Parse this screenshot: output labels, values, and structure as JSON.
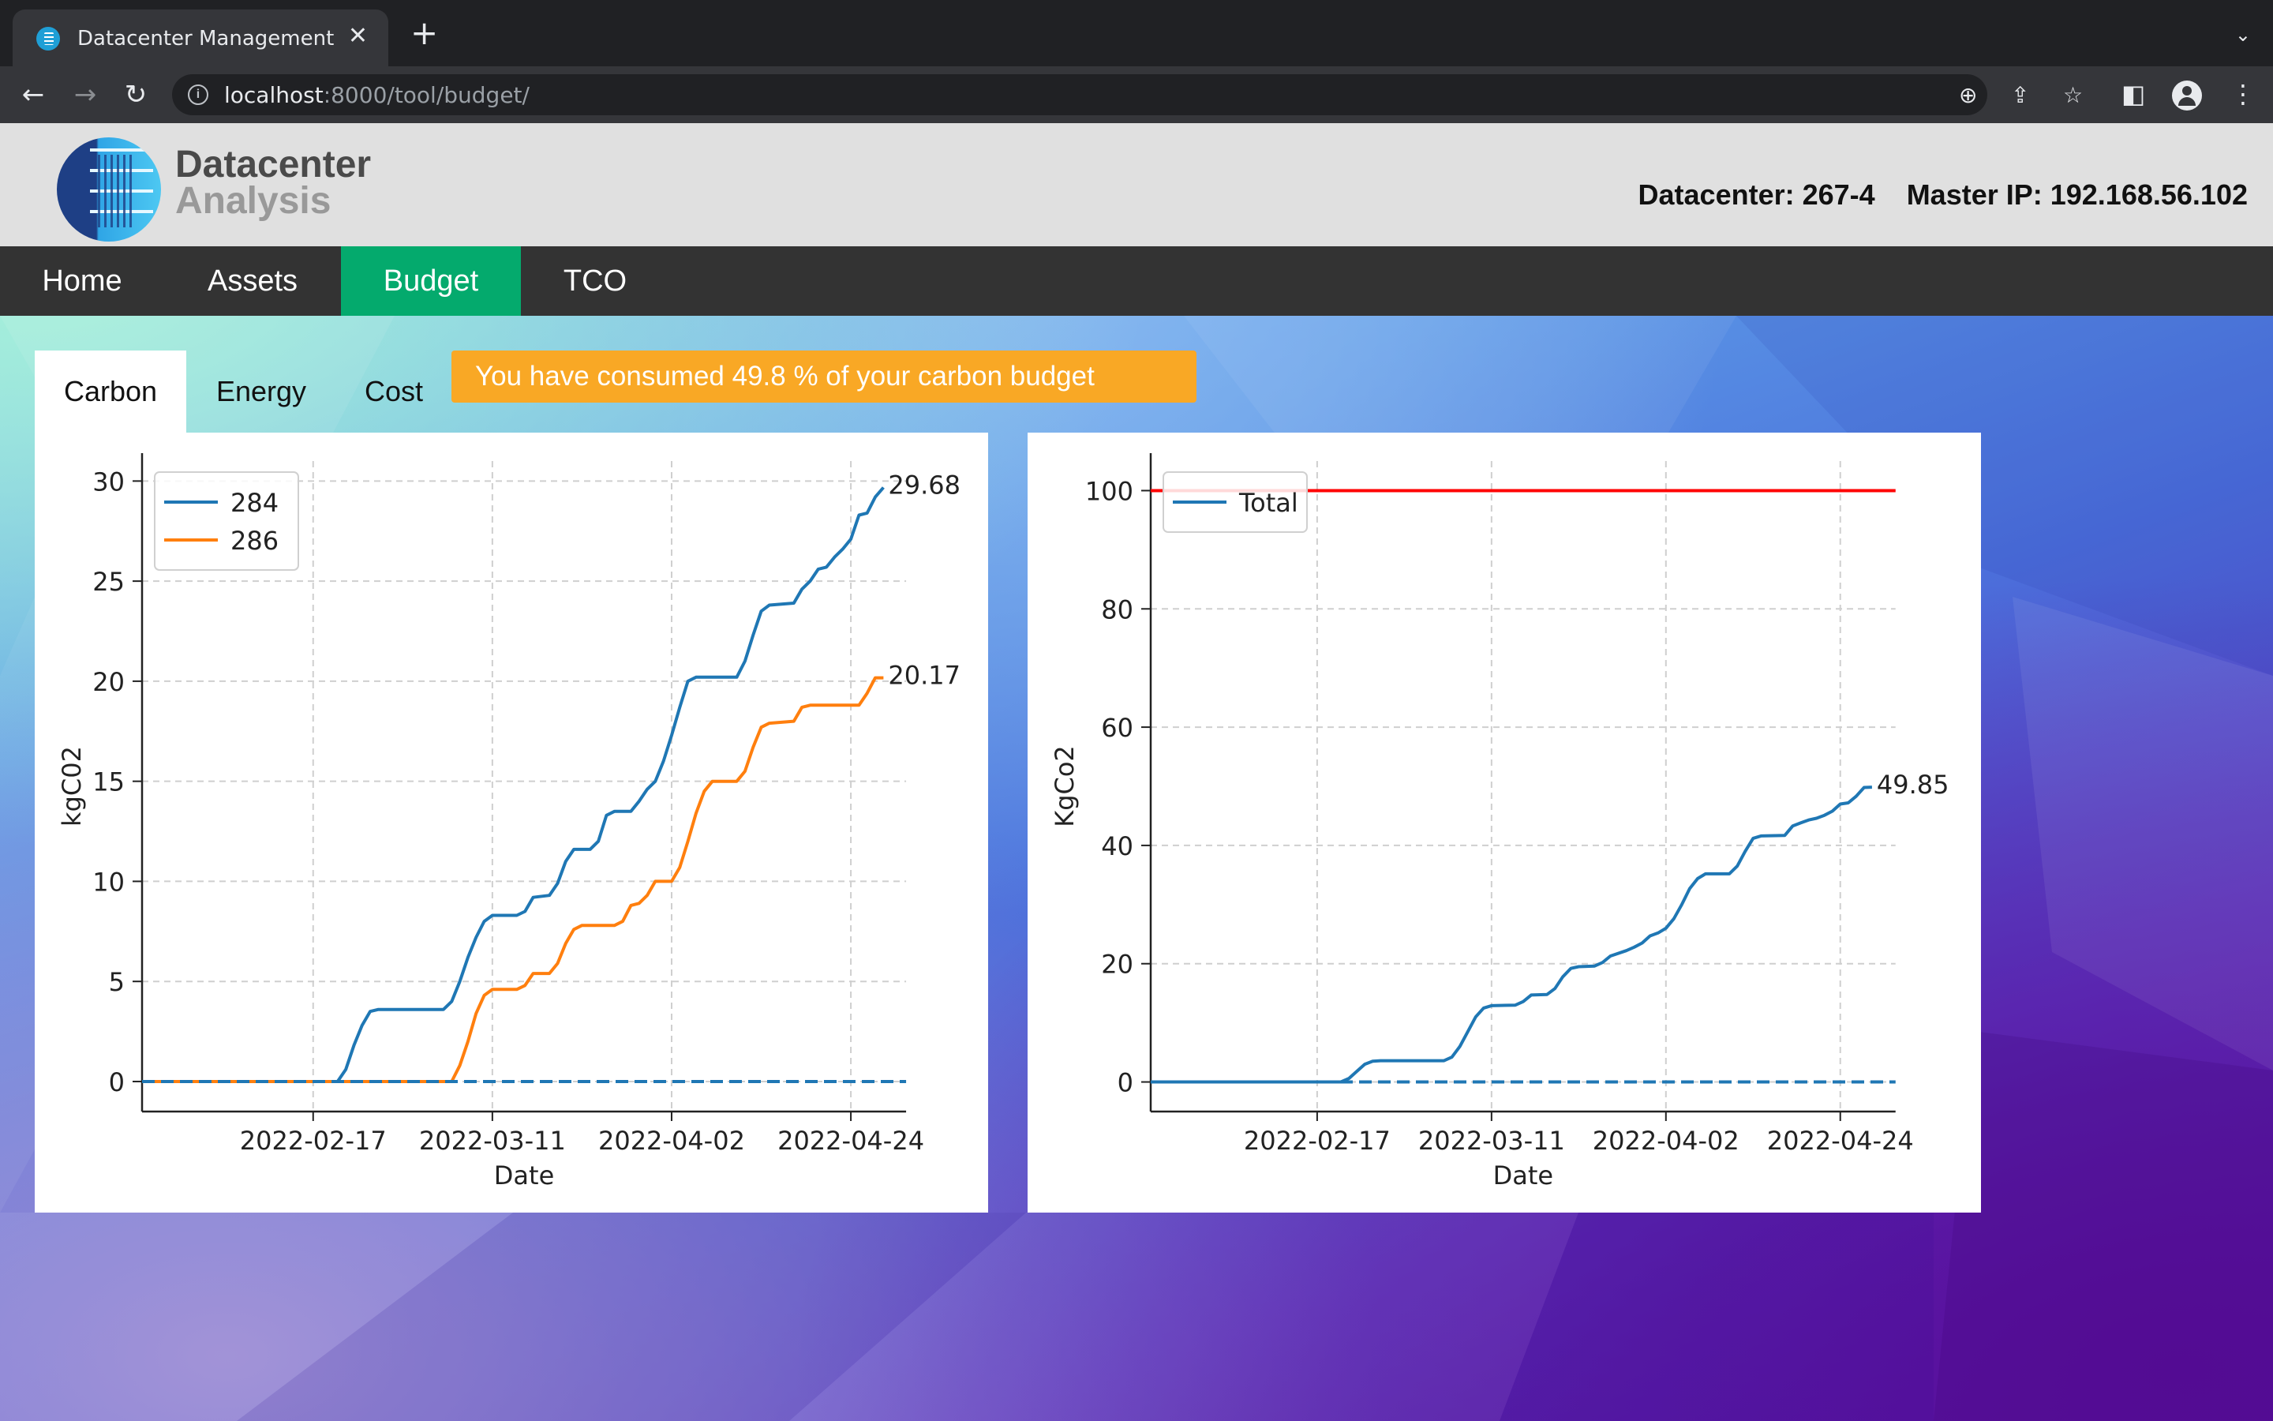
{
  "browser": {
    "tab_title": "Datacenter Management",
    "tab_close": "✕",
    "new_tab": "+",
    "tab_search": "⌄",
    "url_host": "localhost",
    "url_path": ":8000/tool/budget/",
    "back": "←",
    "forward": "→",
    "reload": "↻",
    "zoom": "⊕",
    "share": "⇪",
    "bookmark": "☆",
    "side_panel": "◧",
    "menu": "⋮"
  },
  "header": {
    "logo_title": "Datacenter",
    "logo_subtitle": "Analysis",
    "datacenter": "Datacenter: 267-4",
    "master_ip": "Master IP: 192.168.56.102"
  },
  "nav": {
    "items": [
      {
        "label": "Home",
        "active": false
      },
      {
        "label": "Assets",
        "active": false
      },
      {
        "label": "Budget",
        "active": true
      },
      {
        "label": "TCO",
        "active": false
      }
    ]
  },
  "subtabs": [
    {
      "label": "Carbon",
      "active": true
    },
    {
      "label": "Energy",
      "active": false
    },
    {
      "label": "Cost",
      "active": false
    }
  ],
  "alert": {
    "text": "You have consumed 49.8 % of your carbon budget",
    "color": "#f9a825"
  },
  "colors": {
    "nav_active": "#04aa6d",
    "series_blue": "#1f77b4",
    "series_orange": "#ff7f0e",
    "limit_red": "#ff0000"
  },
  "chart_data": [
    {
      "type": "line",
      "xlabel": "Date",
      "ylabel": "kgC02",
      "xlim": [
        "2022-01-27",
        "2022-04-30"
      ],
      "ylim": [
        -1.5,
        31
      ],
      "yticks": [
        0,
        5,
        10,
        15,
        20,
        25,
        30
      ],
      "xticks": [
        "2022-02-17",
        "2022-03-11",
        "2022-04-02",
        "2022-04-24"
      ],
      "grid": true,
      "legend": "top-left",
      "end_labels": [
        "29.68",
        "20.17"
      ],
      "zero_line": {
        "value": 0,
        "style": "dashed"
      },
      "series": [
        {
          "name": "284",
          "color": "#1f77b4",
          "points": [
            [
              "2022-01-27",
              0
            ],
            [
              "2022-02-20",
              0
            ],
            [
              "2022-02-21",
              0.6
            ],
            [
              "2022-02-22",
              1.8
            ],
            [
              "2022-02-23",
              2.8
            ],
            [
              "2022-02-24",
              3.5
            ],
            [
              "2022-02-25",
              3.6
            ],
            [
              "2022-02-28",
              3.6
            ],
            [
              "2022-03-05",
              3.6
            ],
            [
              "2022-03-06",
              4.0
            ],
            [
              "2022-03-07",
              5.0
            ],
            [
              "2022-03-08",
              6.2
            ],
            [
              "2022-03-09",
              7.2
            ],
            [
              "2022-03-10",
              8.0
            ],
            [
              "2022-03-11",
              8.3
            ],
            [
              "2022-03-14",
              8.3
            ],
            [
              "2022-03-15",
              8.5
            ],
            [
              "2022-03-16",
              9.2
            ],
            [
              "2022-03-18",
              9.3
            ],
            [
              "2022-03-19",
              9.9
            ],
            [
              "2022-03-20",
              11.0
            ],
            [
              "2022-03-21",
              11.6
            ],
            [
              "2022-03-23",
              11.6
            ],
            [
              "2022-03-24",
              12.0
            ],
            [
              "2022-03-25",
              13.3
            ],
            [
              "2022-03-26",
              13.5
            ],
            [
              "2022-03-28",
              13.5
            ],
            [
              "2022-03-29",
              14.0
            ],
            [
              "2022-03-30",
              14.6
            ],
            [
              "2022-03-31",
              15.0
            ],
            [
              "2022-04-01",
              16.0
            ],
            [
              "2022-04-02",
              17.3
            ],
            [
              "2022-04-03",
              18.7
            ],
            [
              "2022-04-04",
              20.0
            ],
            [
              "2022-04-05",
              20.2
            ],
            [
              "2022-04-10",
              20.2
            ],
            [
              "2022-04-11",
              21.0
            ],
            [
              "2022-04-12",
              22.3
            ],
            [
              "2022-04-13",
              23.5
            ],
            [
              "2022-04-14",
              23.8
            ],
            [
              "2022-04-17",
              23.9
            ],
            [
              "2022-04-18",
              24.6
            ],
            [
              "2022-04-19",
              25.0
            ],
            [
              "2022-04-20",
              25.6
            ],
            [
              "2022-04-21",
              25.7
            ],
            [
              "2022-04-22",
              26.2
            ],
            [
              "2022-04-23",
              26.6
            ],
            [
              "2022-04-24",
              27.1
            ],
            [
              "2022-04-25",
              28.3
            ],
            [
              "2022-04-26",
              28.4
            ],
            [
              "2022-04-27",
              29.2
            ],
            [
              "2022-04-28",
              29.68
            ]
          ]
        },
        {
          "name": "286",
          "color": "#ff7f0e",
          "points": [
            [
              "2022-01-27",
              0
            ],
            [
              "2022-03-06",
              0
            ],
            [
              "2022-03-07",
              0.8
            ],
            [
              "2022-03-08",
              2.0
            ],
            [
              "2022-03-09",
              3.4
            ],
            [
              "2022-03-10",
              4.3
            ],
            [
              "2022-03-11",
              4.6
            ],
            [
              "2022-03-14",
              4.6
            ],
            [
              "2022-03-15",
              4.8
            ],
            [
              "2022-03-16",
              5.4
            ],
            [
              "2022-03-18",
              5.4
            ],
            [
              "2022-03-19",
              5.9
            ],
            [
              "2022-03-20",
              6.9
            ],
            [
              "2022-03-21",
              7.6
            ],
            [
              "2022-03-22",
              7.8
            ],
            [
              "2022-03-26",
              7.8
            ],
            [
              "2022-03-27",
              8.0
            ],
            [
              "2022-03-28",
              8.8
            ],
            [
              "2022-03-29",
              8.9
            ],
            [
              "2022-03-30",
              9.3
            ],
            [
              "2022-03-31",
              10.0
            ],
            [
              "2022-04-02",
              10.0
            ],
            [
              "2022-04-03",
              10.7
            ],
            [
              "2022-04-04",
              12.0
            ],
            [
              "2022-04-05",
              13.4
            ],
            [
              "2022-04-06",
              14.5
            ],
            [
              "2022-04-07",
              15.0
            ],
            [
              "2022-04-10",
              15.0
            ],
            [
              "2022-04-11",
              15.5
            ],
            [
              "2022-04-12",
              16.7
            ],
            [
              "2022-04-13",
              17.7
            ],
            [
              "2022-04-14",
              17.9
            ],
            [
              "2022-04-17",
              18.0
            ],
            [
              "2022-04-18",
              18.7
            ],
            [
              "2022-04-19",
              18.8
            ],
            [
              "2022-04-24",
              18.8
            ],
            [
              "2022-04-25",
              18.8
            ],
            [
              "2022-04-26",
              19.4
            ],
            [
              "2022-04-27",
              20.17
            ],
            [
              "2022-04-28",
              20.17
            ]
          ]
        }
      ]
    },
    {
      "type": "line",
      "xlabel": "Date",
      "ylabel": "KgCo2",
      "xlim": [
        "2022-01-27",
        "2022-04-30"
      ],
      "ylim": [
        -5,
        105
      ],
      "yticks": [
        0,
        20,
        40,
        60,
        80,
        100
      ],
      "xticks": [
        "2022-02-17",
        "2022-03-11",
        "2022-04-02",
        "2022-04-24"
      ],
      "grid": true,
      "legend": "top-left",
      "end_labels": [
        "49.85"
      ],
      "zero_line": {
        "value": 0,
        "style": "dashed"
      },
      "limit_line": {
        "value": 100,
        "color": "#ff0000"
      },
      "series": [
        {
          "name": "Total",
          "color": "#1f77b4",
          "points": [
            [
              "2022-01-27",
              0
            ],
            [
              "2022-02-20",
              0
            ],
            [
              "2022-02-21",
              0.6
            ],
            [
              "2022-02-22",
              1.8
            ],
            [
              "2022-02-23",
              3.0
            ],
            [
              "2022-02-24",
              3.5
            ],
            [
              "2022-02-25",
              3.6
            ],
            [
              "2022-03-05",
              3.6
            ],
            [
              "2022-03-06",
              4.2
            ],
            [
              "2022-03-07",
              6.0
            ],
            [
              "2022-03-08",
              8.5
            ],
            [
              "2022-03-09",
              11.0
            ],
            [
              "2022-03-10",
              12.5
            ],
            [
              "2022-03-11",
              12.9
            ],
            [
              "2022-03-14",
              13.0
            ],
            [
              "2022-03-15",
              13.6
            ],
            [
              "2022-03-16",
              14.7
            ],
            [
              "2022-03-18",
              14.8
            ],
            [
              "2022-03-19",
              15.8
            ],
            [
              "2022-03-20",
              17.8
            ],
            [
              "2022-03-21",
              19.2
            ],
            [
              "2022-03-22",
              19.5
            ],
            [
              "2022-03-24",
              19.6
            ],
            [
              "2022-03-25",
              20.2
            ],
            [
              "2022-03-26",
              21.3
            ],
            [
              "2022-03-28",
              22.2
            ],
            [
              "2022-03-29",
              22.8
            ],
            [
              "2022-03-30",
              23.5
            ],
            [
              "2022-03-31",
              24.7
            ],
            [
              "2022-04-01",
              25.2
            ],
            [
              "2022-04-02",
              26.0
            ],
            [
              "2022-04-03",
              27.6
            ],
            [
              "2022-04-04",
              30.0
            ],
            [
              "2022-04-05",
              32.7
            ],
            [
              "2022-04-06",
              34.4
            ],
            [
              "2022-04-07",
              35.2
            ],
            [
              "2022-04-10",
              35.2
            ],
            [
              "2022-04-11",
              36.5
            ],
            [
              "2022-04-12",
              39.0
            ],
            [
              "2022-04-13",
              41.2
            ],
            [
              "2022-04-14",
              41.6
            ],
            [
              "2022-04-17",
              41.7
            ],
            [
              "2022-04-18",
              43.3
            ],
            [
              "2022-04-19",
              43.8
            ],
            [
              "2022-04-20",
              44.3
            ],
            [
              "2022-04-21",
              44.6
            ],
            [
              "2022-04-22",
              45.1
            ],
            [
              "2022-04-23",
              45.8
            ],
            [
              "2022-04-24",
              47.0
            ],
            [
              "2022-04-25",
              47.2
            ],
            [
              "2022-04-26",
              48.3
            ],
            [
              "2022-04-27",
              49.8
            ],
            [
              "2022-04-28",
              49.85
            ]
          ]
        }
      ]
    }
  ]
}
